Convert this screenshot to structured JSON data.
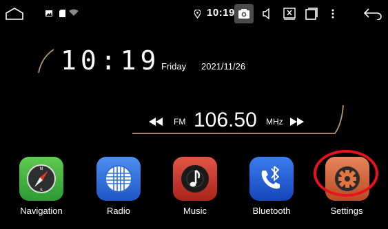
{
  "status_bar": {
    "time": "10:19",
    "icons": [
      "home-icon",
      "image-icon",
      "sd-card-icon",
      "wifi-icon",
      "location-icon",
      "camera-icon",
      "volume-icon",
      "close-box-icon",
      "recents-icon",
      "more-vert-icon",
      "back-icon"
    ]
  },
  "clock_widget": {
    "time": "10:19",
    "day": "Friday",
    "date": "2021/11/26"
  },
  "radio_widget": {
    "band": "FM",
    "frequency": "106.50",
    "unit": "MHz"
  },
  "apps": [
    {
      "label": "Navigation",
      "icon": "compass-icon",
      "color": "#3aa640"
    },
    {
      "label": "Radio",
      "icon": "radio-globe-icon",
      "color": "#2f6fd6"
    },
    {
      "label": "Music",
      "icon": "music-note-icon",
      "color": "#d2382a"
    },
    {
      "label": "Bluetooth",
      "icon": "bluetooth-phone-icon",
      "color": "#1d5fd8"
    },
    {
      "label": "Settings",
      "icon": "gear-icon",
      "color": "#d9683a"
    }
  ],
  "highlight_color": "#e8121d"
}
